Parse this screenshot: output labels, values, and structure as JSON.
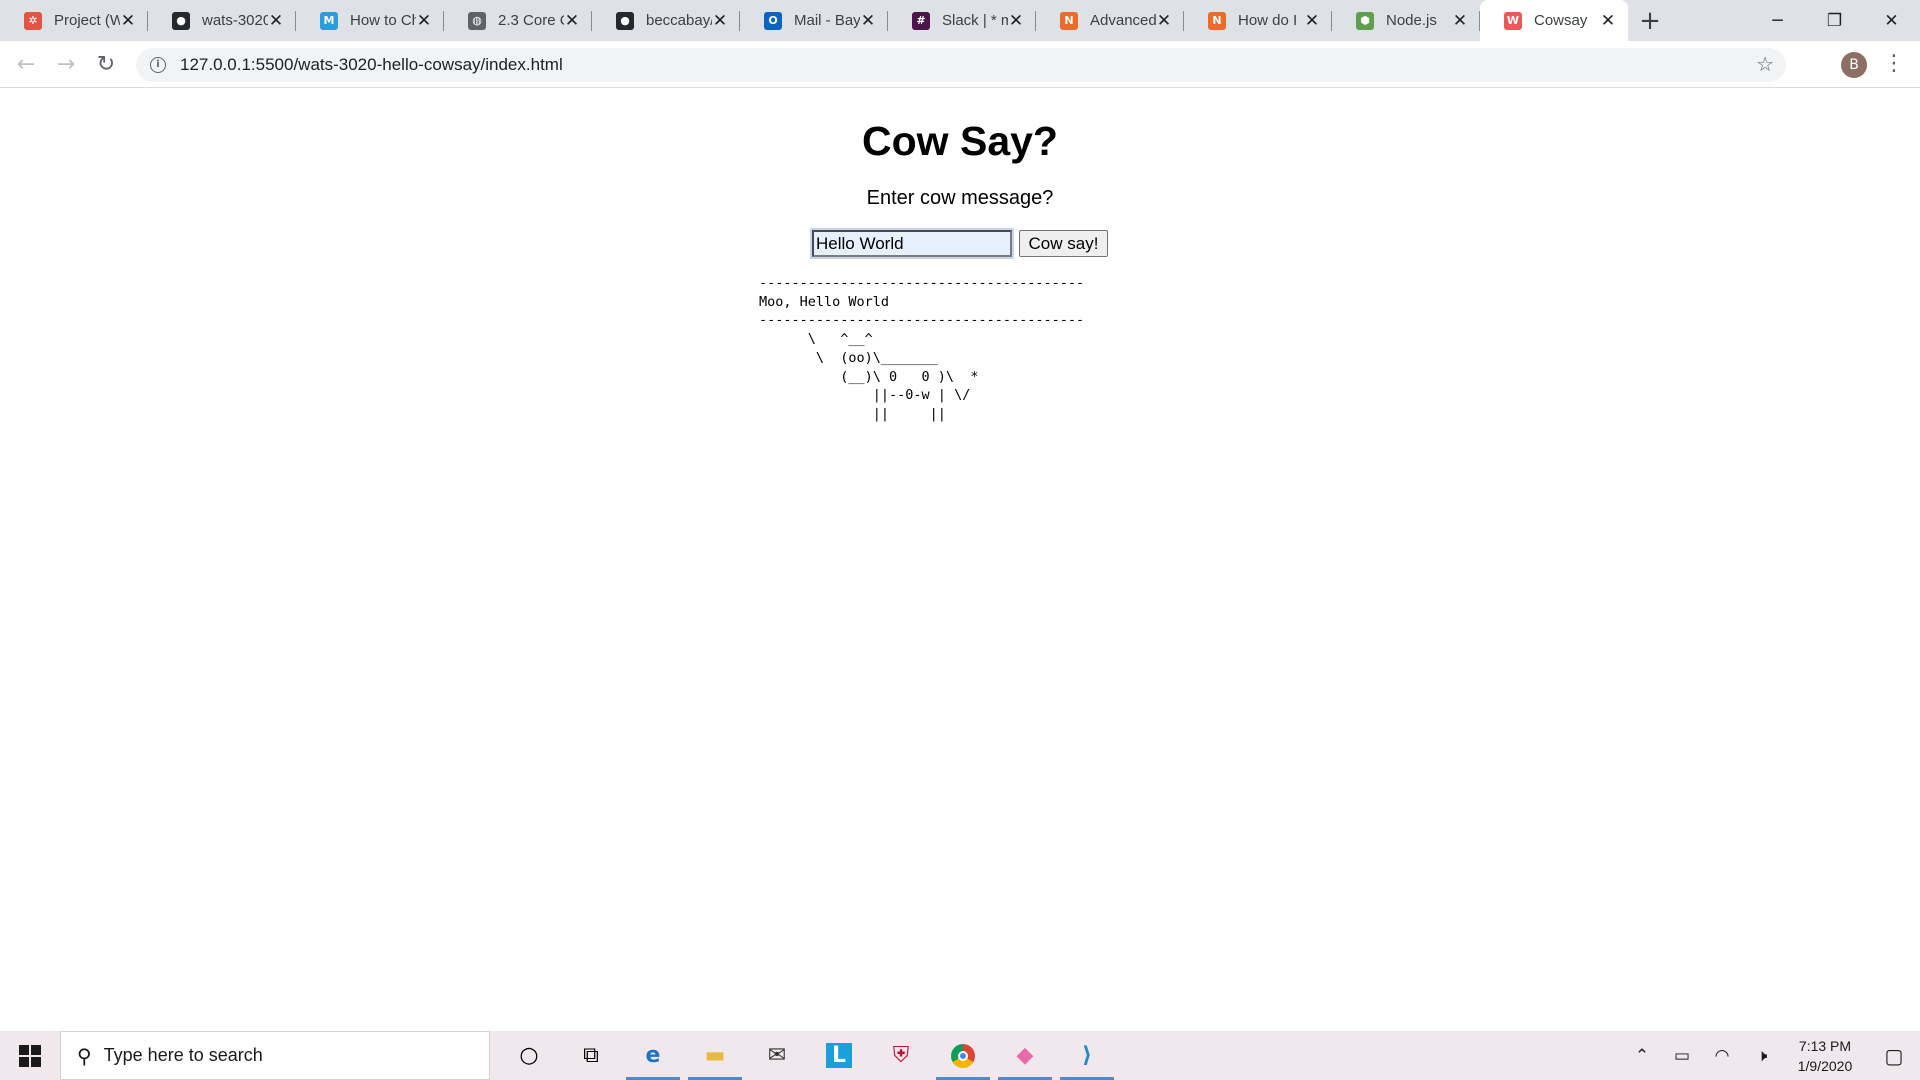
{
  "browser": {
    "tabs": [
      {
        "title": "Project (W",
        "favicon": "project-icon",
        "color": "#e25545",
        "glyph": "✲"
      },
      {
        "title": "wats-3020",
        "favicon": "github-icon",
        "color": "#24292e",
        "glyph": "●"
      },
      {
        "title": "How to Ch",
        "favicon": "m-icon",
        "color": "#2d9cdb",
        "glyph": "M"
      },
      {
        "title": "2.3 Core C",
        "favicon": "globe-icon",
        "color": "#5f6368",
        "glyph": "◍"
      },
      {
        "title": "beccabay/",
        "favicon": "github-icon",
        "color": "#24292e",
        "glyph": "●"
      },
      {
        "title": "Mail - Bay",
        "favicon": "outlook-icon",
        "color": "#0a64c2",
        "glyph": "O"
      },
      {
        "title": "Slack | * m",
        "favicon": "slack-icon",
        "color": "#4a154b",
        "glyph": "#"
      },
      {
        "title": "Advanced",
        "favicon": "tutorial-icon",
        "color": "#ec6a2a",
        "glyph": "N"
      },
      {
        "title": "How do I",
        "favicon": "tutorial-icon",
        "color": "#ec6a2a",
        "glyph": "N"
      },
      {
        "title": "Node.js",
        "favicon": "nodejs-icon",
        "color": "#5fa04e",
        "glyph": "⬢"
      },
      {
        "title": "Cowsay",
        "favicon": "cowsay-icon",
        "color": "#e85a5a",
        "glyph": "W"
      }
    ],
    "active_tab": 10,
    "new_tab_label": "+",
    "url": "127.0.0.1:5500/wats-3020-hello-cowsay/index.html",
    "profile_initial": "B"
  },
  "page": {
    "title": "Cow Say?",
    "prompt": "Enter cow message?",
    "input_value": "Hello World",
    "button_label": "Cow say!",
    "cow_output": "----------------------------------------\nMoo, Hello World\n----------------------------------------\n      \\   ^__^\n       \\  (oo)\\_______\n          (__)\\ 0   0 )\\  *\n              ||--0-w | \\/\n              ||     ||"
  },
  "taskbar": {
    "search_placeholder": "Type here to search",
    "time": "7:13 PM",
    "date": "1/9/2020"
  }
}
